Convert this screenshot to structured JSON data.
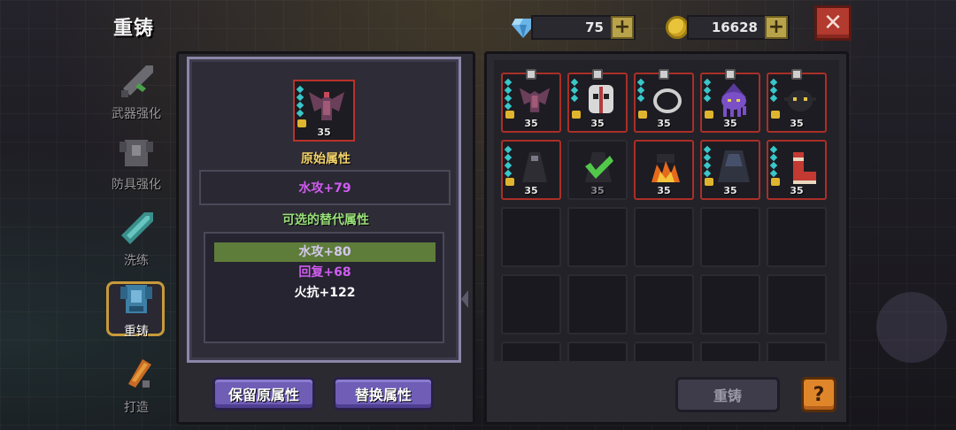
{
  "header": {
    "title": "重铸"
  },
  "currency": {
    "gems": "75",
    "coins": "16628",
    "plus_label": "+"
  },
  "close_label": "✕",
  "nav": [
    {
      "id": "weapon",
      "label": "武器强化",
      "icon": "sword-icon"
    },
    {
      "id": "armor",
      "label": "防具强化",
      "icon": "armor-icon"
    },
    {
      "id": "wash",
      "label": "洗练",
      "icon": "crystal-sword-icon"
    },
    {
      "id": "recast",
      "label": "重铸",
      "icon": "armor-blue-icon",
      "active": true
    },
    {
      "id": "forge",
      "label": "打造",
      "icon": "hammer-icon"
    }
  ],
  "selected_item": {
    "level": "35"
  },
  "original": {
    "heading": "原始属性",
    "value": "水攻+79"
  },
  "alternatives": {
    "heading": "可选的替代属性",
    "rows": [
      {
        "text": "水攻+80",
        "selected": true
      },
      {
        "text": "回复+68"
      },
      {
        "text": "火抗+122"
      }
    ]
  },
  "buttons": {
    "keep": "保留原属性",
    "replace": "替换属性",
    "recast": "重铸",
    "help": "?"
  },
  "inventory": {
    "slots": [
      {
        "level": "35",
        "icon": "bat-armor-icon",
        "filled": true
      },
      {
        "level": "35",
        "icon": "skull-mask-icon",
        "filled": true
      },
      {
        "level": "35",
        "icon": "ring-icon",
        "filled": true
      },
      {
        "level": "35",
        "icon": "octopus-icon",
        "filled": true
      },
      {
        "level": "35",
        "icon": "spider-helm-icon",
        "filled": true
      },
      {
        "level": "35",
        "icon": "dark-cloak-icon",
        "filled": true
      },
      {
        "level": "35",
        "icon": "check-icon",
        "filled": true,
        "equipped": true
      },
      {
        "level": "35",
        "icon": "fire-boots-icon",
        "filled": true
      },
      {
        "level": "35",
        "icon": "dark-robe-icon",
        "filled": true
      },
      {
        "level": "35",
        "icon": "red-boots-icon",
        "filled": true
      }
    ]
  },
  "colors": {
    "accent_purple": "#6f5db6",
    "selected_row": "#5f7d3a",
    "water_attr": "#d05cf0",
    "heading_yellow": "#f3d36a",
    "heading_green": "#9ae07a"
  }
}
